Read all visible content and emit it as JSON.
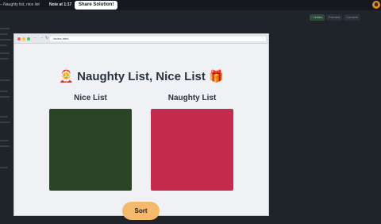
{
  "topbar": {
    "title": "– Naughty list, nice list",
    "note": "Note at 1:17",
    "share_label": "Share Solution!"
  },
  "editor": {
    "tabs": [
      "+ index",
      "Preview",
      "Console"
    ]
  },
  "browser": {
    "url": "/index.html",
    "nav_arrows": "← →",
    "url_icon": "↻",
    "menu_icon": "⋮"
  },
  "page": {
    "title": "🤶 Naughty List, Nice List 🎁",
    "nice_title": "Nice List",
    "naughty_title": "Naughty List",
    "sort_label": "Sort"
  },
  "colors": {
    "nice_box": "#2b4425",
    "naughty_box": "#c32c4f",
    "sort_button": "#f5b96b"
  }
}
